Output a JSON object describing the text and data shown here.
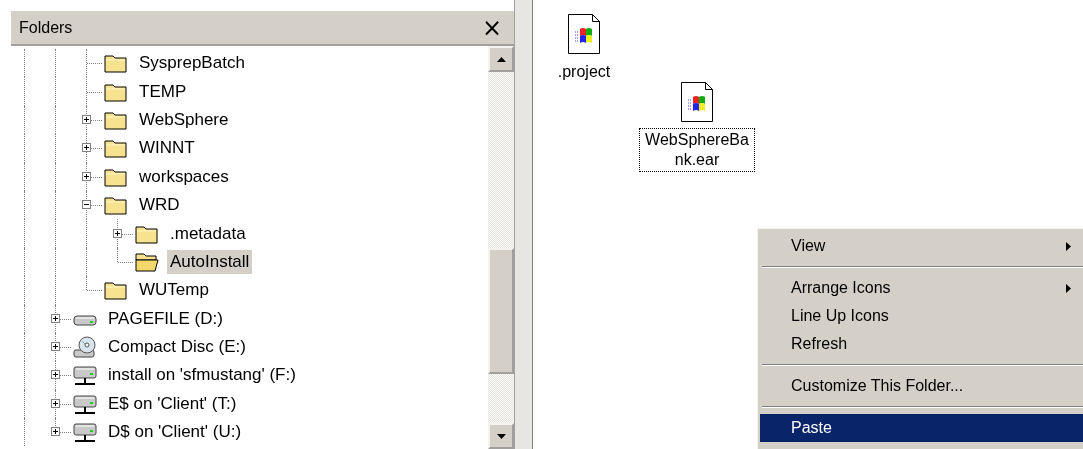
{
  "folders_pane": {
    "title": "Folders",
    "close": "×",
    "tree": [
      {
        "children": [
          {
            "label": "SysprepBatch",
            "kind": "folder",
            "selected": false
          },
          {
            "label": "TEMP",
            "kind": "folder",
            "selected": false
          },
          {
            "label": "WebSphere",
            "kind": "folder",
            "expanded": false,
            "selected": false
          },
          {
            "label": "WINNT",
            "kind": "folder",
            "expanded": false,
            "selected": false
          },
          {
            "label": "workspaces",
            "kind": "folder",
            "expanded": false,
            "selected": false
          },
          {
            "label": "WRD",
            "kind": "folder",
            "expanded": true,
            "selected": false,
            "children": [
              {
                "label": ".metadata",
                "kind": "folder",
                "expanded": false,
                "selected": false
              },
              {
                "label": "AutoInstall",
                "kind": "folder",
                "selected": true
              }
            ]
          },
          {
            "label": "WUTemp",
            "kind": "folder",
            "selected": false
          }
        ]
      },
      {
        "label": "PAGEFILE (D:)",
        "kind": "drive",
        "expanded": false,
        "selected": false
      },
      {
        "label": "Compact Disc (E:)",
        "kind": "cd",
        "expanded": false,
        "selected": false
      },
      {
        "label": "install on 'sfmustang' (F:)",
        "kind": "network",
        "expanded": false,
        "selected": false
      },
      {
        "label": "E$ on 'Client' (T:)",
        "kind": "network",
        "expanded": false,
        "selected": false
      },
      {
        "label": "D$ on 'Client' (U:)",
        "kind": "network",
        "expanded": false,
        "selected": false
      }
    ]
  },
  "files": [
    {
      "name": ".project",
      "selected": false
    },
    {
      "name": "WebSphereBank.ear",
      "selected": true
    }
  ],
  "context_menu": [
    {
      "kind": "item",
      "label": "View",
      "submenu": true,
      "selected": false
    },
    {
      "kind": "separator"
    },
    {
      "kind": "item",
      "label": "Arrange Icons",
      "submenu": true,
      "selected": false
    },
    {
      "kind": "item",
      "label": "Line Up Icons",
      "submenu": false,
      "selected": false
    },
    {
      "kind": "item",
      "label": "Refresh",
      "submenu": false,
      "selected": false
    },
    {
      "kind": "separator"
    },
    {
      "kind": "item",
      "label": "Customize This Folder...",
      "submenu": false,
      "selected": false
    },
    {
      "kind": "separator"
    },
    {
      "kind": "item",
      "label": "Paste",
      "submenu": false,
      "selected": true
    }
  ]
}
